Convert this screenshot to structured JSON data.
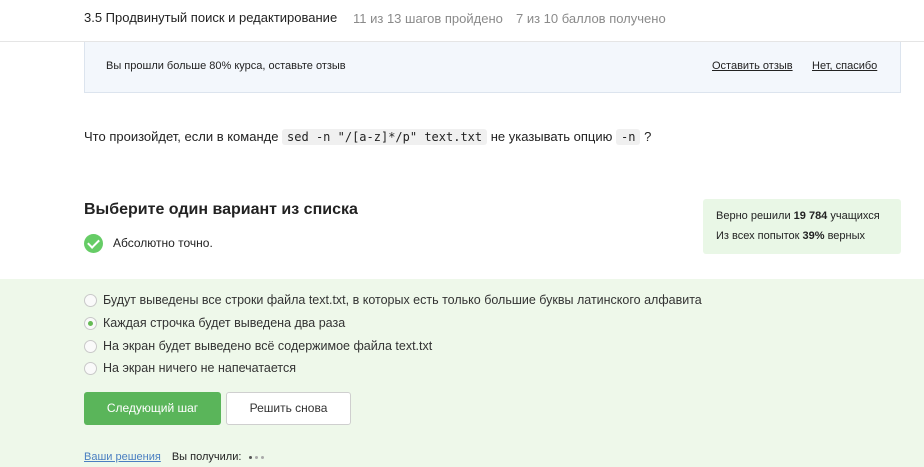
{
  "header": {
    "lesson_title": "3.5 Продвинутый поиск и редактирование",
    "steps_progress": "11 из 13 шагов пройдено",
    "score_progress": "7 из 10 баллов  получено"
  },
  "banner": {
    "message": "Вы прошли больше 80% курса, оставьте отзыв",
    "review_link": "Оставить отзыв",
    "dismiss_link": "Нет, спасибо"
  },
  "question": {
    "text_before": "Что произойдет, если в команде ",
    "command": "sed -n \"/[a-z]*/p\" text.txt",
    "text_middle": " не указывать опцию ",
    "option_code": "-n",
    "text_after": " ?"
  },
  "task": {
    "title": "Выберите один вариант из списка",
    "feedback": "Абсолютно точно."
  },
  "stats": {
    "solved_prefix": "Верно решили ",
    "solved_count": "19 784",
    "solved_suffix": " учащихся",
    "attempts_prefix": "Из всех попыток ",
    "attempts_percent": "39%",
    "attempts_suffix": " верных"
  },
  "options": [
    {
      "label": "Будут выведены все строки файла text.txt, в которых есть только большие буквы латинского алфавита",
      "selected": false
    },
    {
      "label": "Каждая строчка будет выведена два раза",
      "selected": true
    },
    {
      "label": "На экран будет выведено всё содержимое файла text.txt",
      "selected": false
    },
    {
      "label": "На экран ничего не напечатается",
      "selected": false
    }
  ],
  "actions": {
    "next_label": "Следующий шаг",
    "retry_label": "Решить снова"
  },
  "footer": {
    "solutions_link": "Ваши решения",
    "received_label": "Вы получили:",
    "points_earned": 1,
    "points_total": 3
  },
  "colors": {
    "accent_green": "#5ab55a",
    "check_green": "#66cc66",
    "answer_bg": "#eef8ea",
    "link_blue": "#4a7fc1"
  },
  "icons": {
    "feedback": "check-circle-icon",
    "points": "score-dots-icon"
  }
}
